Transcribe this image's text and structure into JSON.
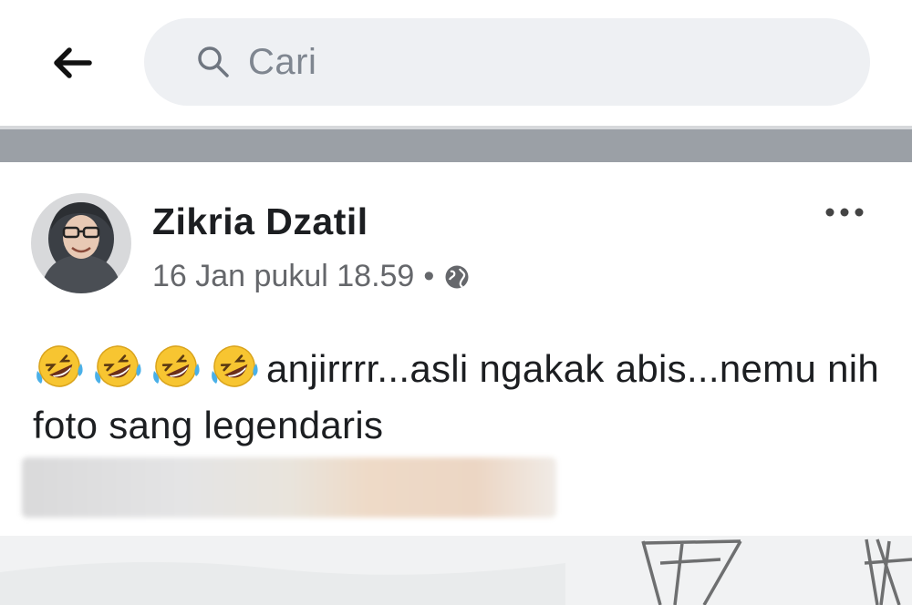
{
  "search": {
    "back_icon": "arrow-left-icon",
    "search_icon": "search-icon",
    "placeholder": "Cari"
  },
  "post": {
    "author": "Zikria Dzatil",
    "timestamp": "16 Jan pukul 18.59",
    "separator": "•",
    "privacy_icon": "globe-icon",
    "more_icon": "more-horizontal-icon",
    "reaction_emoji": "rolling-on-the-floor-laughing",
    "emoji_count": 4,
    "text": "anjirrrr...asli ngakak abis...nemu nih foto sang legendaris"
  },
  "colors": {
    "search_bg": "#eef0f3",
    "divider": "#9ba0a6",
    "name": "#1c1e21",
    "meta": "#65676b"
  }
}
